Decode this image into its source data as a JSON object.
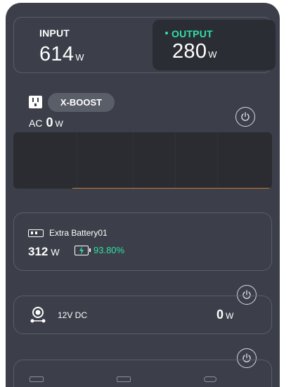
{
  "io": {
    "input_label": "INPUT",
    "input_value": "614",
    "input_unit": "W",
    "output_label": "OUTPUT",
    "output_value": "280",
    "output_unit": "W"
  },
  "ac": {
    "icon": "ac-outlet-icon",
    "xboost_label": "X-BOOST",
    "label": "AC",
    "value": "0",
    "unit": "W"
  },
  "extra_battery": {
    "icon": "battery-pack-icon",
    "name": "Extra Battery01",
    "watts": "312",
    "unit": "W",
    "charge_icon": "charging-battery-icon",
    "percent": "93.80%"
  },
  "dc": {
    "icon": "car-outlet-icon",
    "label": "12V DC",
    "value": "0",
    "unit": "W"
  },
  "usb": {
    "icons": [
      "usb-a-port-icon",
      "usb-a-port-icon",
      "usb-c-port-icon"
    ]
  },
  "colors": {
    "background": "#3c3f49",
    "panel_dark": "#2b2d34",
    "accent_green": "#2fe0a6",
    "waveform_line": "#c27a3a"
  }
}
